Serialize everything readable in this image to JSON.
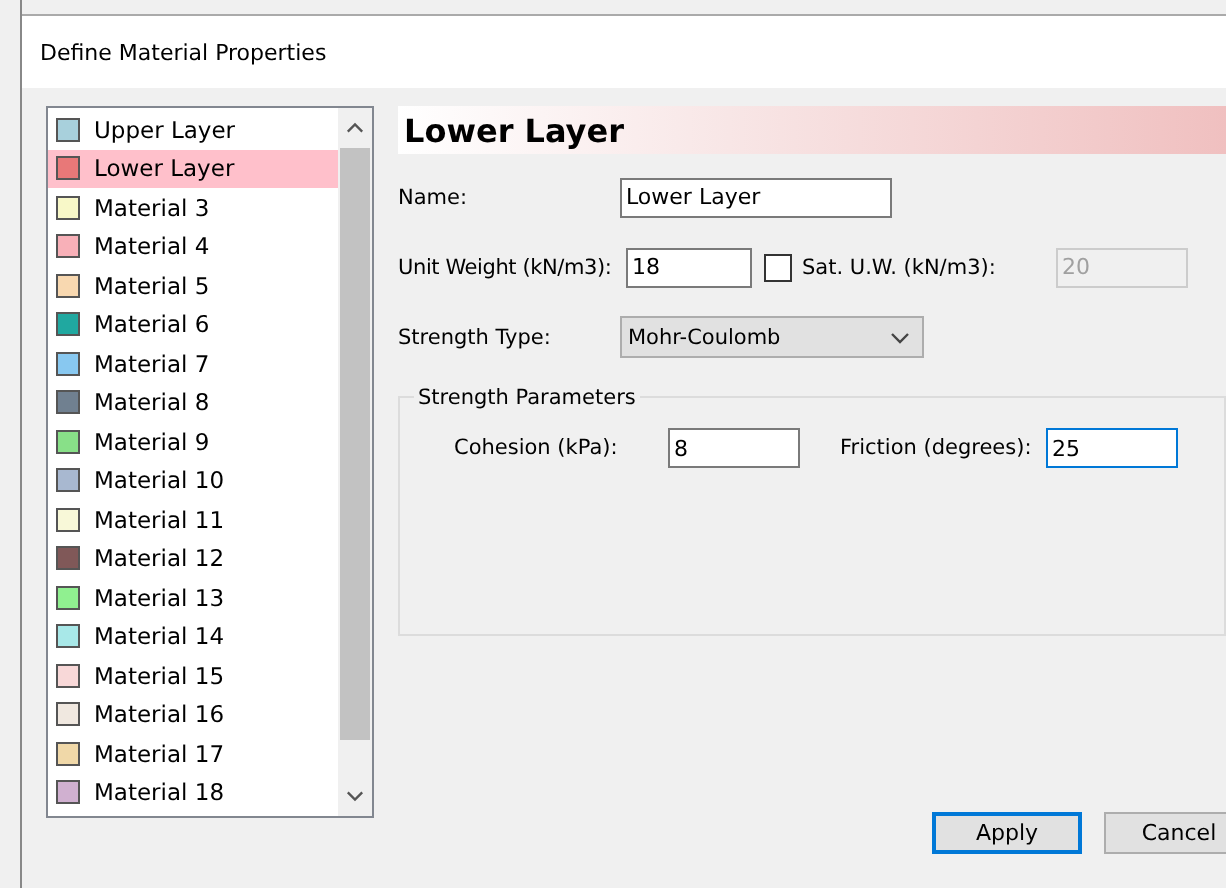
{
  "window": {
    "title": "Define Material Properties"
  },
  "materials": [
    {
      "name": "Upper Layer",
      "color": "#a8d0dc",
      "selected": false
    },
    {
      "name": "Lower Layer",
      "color": "#e87878",
      "selected": true
    },
    {
      "name": "Material 3",
      "color": "#f8f8c8",
      "selected": false
    },
    {
      "name": "Material 4",
      "color": "#f8b0b8",
      "selected": false
    },
    {
      "name": "Material 5",
      "color": "#f8d8b0",
      "selected": false
    },
    {
      "name": "Material 6",
      "color": "#20a8a0",
      "selected": false
    },
    {
      "name": "Material 7",
      "color": "#88c8f0",
      "selected": false
    },
    {
      "name": "Material 8",
      "color": "#708090",
      "selected": false
    },
    {
      "name": "Material 9",
      "color": "#88e088",
      "selected": false
    },
    {
      "name": "Material 10",
      "color": "#a8b8d0",
      "selected": false
    },
    {
      "name": "Material 11",
      "color": "#f8f8d8",
      "selected": false
    },
    {
      "name": "Material 12",
      "color": "#805858",
      "selected": false
    },
    {
      "name": "Material 13",
      "color": "#90f090",
      "selected": false
    },
    {
      "name": "Material 14",
      "color": "#a8e8e8",
      "selected": false
    },
    {
      "name": "Material 15",
      "color": "#f8d8d8",
      "selected": false
    },
    {
      "name": "Material 16",
      "color": "#f0e8e0",
      "selected": false
    },
    {
      "name": "Material 17",
      "color": "#f0d8a8",
      "selected": false
    },
    {
      "name": "Material 18",
      "color": "#d0b0d0",
      "selected": false
    }
  ],
  "header": "Lower Layer",
  "name_field": {
    "label": "Name:",
    "value": "Lower Layer"
  },
  "unit_weight": {
    "label": "Unit Weight (kN/m3):",
    "value": "18"
  },
  "sat_uw": {
    "label": "Sat. U.W. (kN/m3):",
    "checked": false,
    "value": "20"
  },
  "strength_type": {
    "label": "Strength Type:",
    "value": "Mohr-Coulomb"
  },
  "strength_parameters": {
    "title": "Strength Parameters",
    "cohesion": {
      "label": "Cohesion (kPa):",
      "value": "8"
    },
    "friction": {
      "label": "Friction (degrees):",
      "value": "25"
    }
  },
  "buttons": [
    {
      "label": "Apply",
      "default": true
    },
    {
      "label": "Cancel",
      "default": false
    }
  ]
}
